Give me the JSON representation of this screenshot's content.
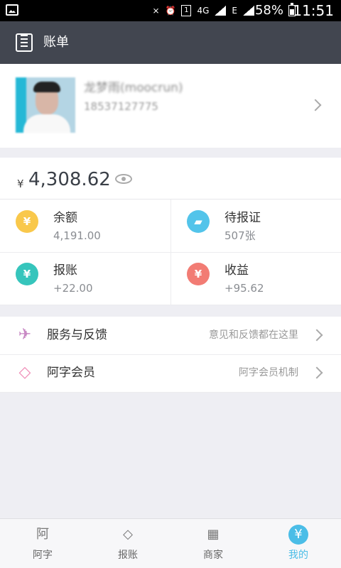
{
  "status": {
    "battery": "58%",
    "time": "11:51",
    "network": "4G",
    "sim": "1",
    "extra": "E"
  },
  "header": {
    "title": "账单"
  },
  "profile": {
    "name": "龙梦雨(moocrun)",
    "phone": "18537127775"
  },
  "balance": {
    "currency": "¥",
    "amount": "4,308.62"
  },
  "stats": [
    {
      "label": "余额",
      "value": "4,191.00",
      "icon": "yen-icon",
      "color": "#f9c84b",
      "glyph": "¥"
    },
    {
      "label": "待报证",
      "value": "507张",
      "icon": "ticket-icon",
      "color": "#53c4ea",
      "glyph": "▰"
    },
    {
      "label": "报账",
      "value": "+22.00",
      "icon": "receipt-icon",
      "color": "#36c5bc",
      "glyph": "¥"
    },
    {
      "label": "收益",
      "value": "+95.62",
      "icon": "income-icon",
      "color": "#f27c74",
      "glyph": "¥"
    }
  ],
  "menu": [
    {
      "label": "服务与反馈",
      "hint": "意见和反馈都在这里",
      "icon": "paper-plane-icon",
      "glyph": "✈"
    },
    {
      "label": "阿字会员",
      "hint": "阿字会员机制",
      "icon": "diamond-icon",
      "glyph": "◇"
    }
  ],
  "tabs": [
    {
      "label": "阿字",
      "icon": "a-zi-icon",
      "glyph": "阿"
    },
    {
      "label": "报账",
      "icon": "layers-icon",
      "glyph": "◇"
    },
    {
      "label": "商家",
      "icon": "shop-icon",
      "glyph": "▦"
    },
    {
      "label": "我的",
      "icon": "my-icon",
      "glyph": "¥"
    }
  ],
  "colors": {
    "appbar": "#424650",
    "active": "#4bbde7",
    "background": "#eeeef3"
  }
}
